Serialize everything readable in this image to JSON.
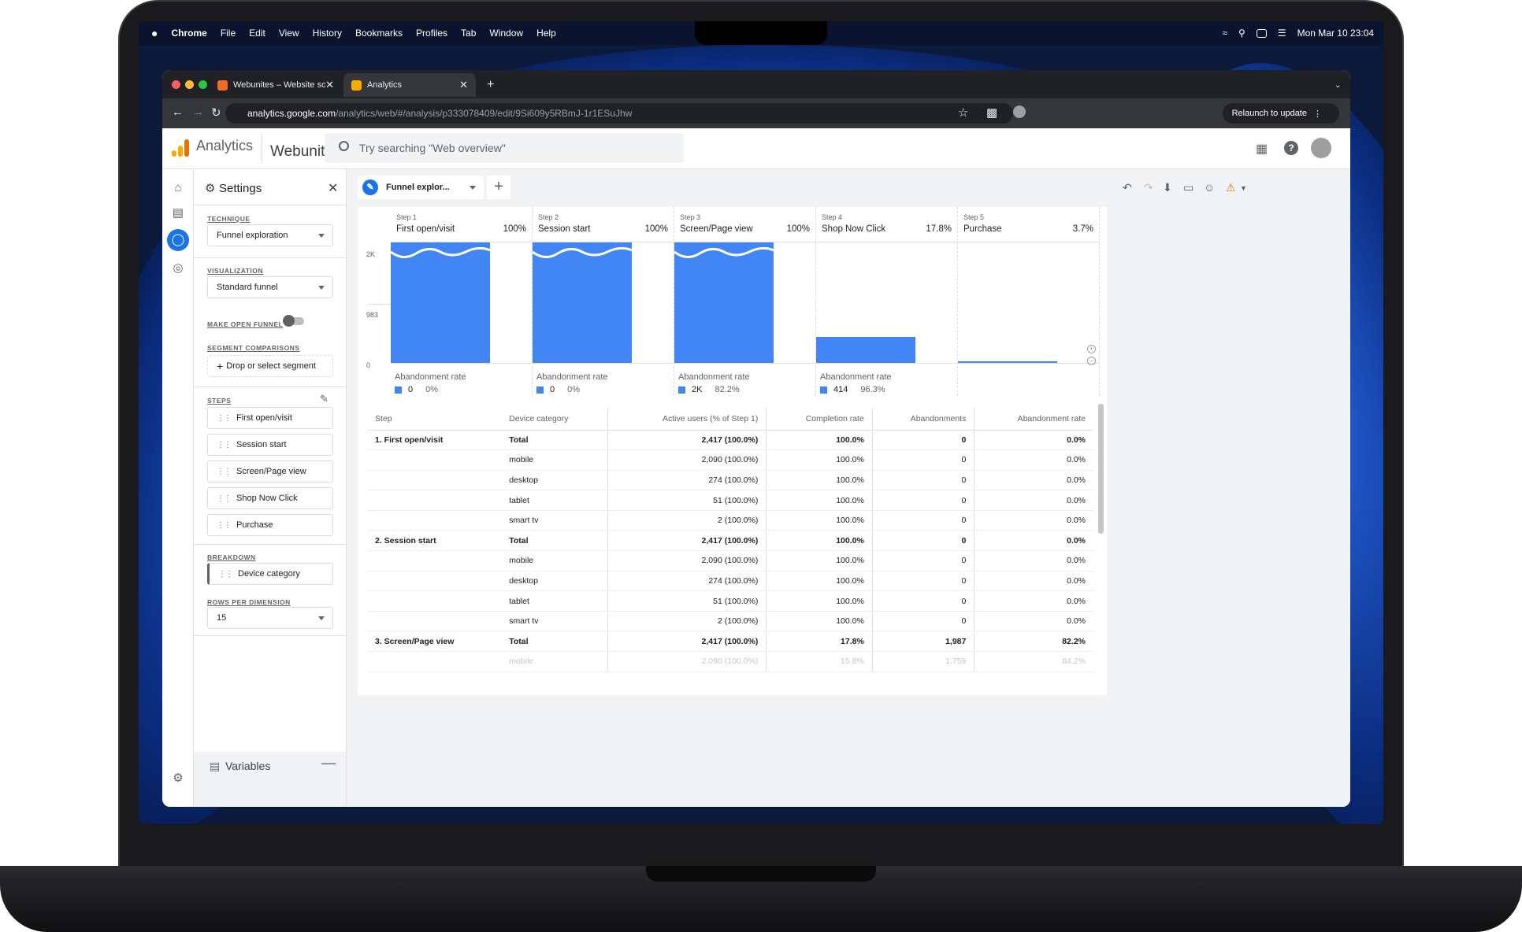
{
  "menubar": {
    "apple": "",
    "items": [
      "Chrome",
      "File",
      "Edit",
      "View",
      "History",
      "Bookmarks",
      "Profiles",
      "Tab",
      "Window",
      "Help"
    ],
    "clock": "Mon Mar 10  23:04"
  },
  "browser": {
    "tabs": [
      {
        "title": "Webunites – Website solution"
      },
      {
        "title": "Analytics"
      }
    ],
    "url_host": "analytics.google.com",
    "url_path": "/analytics/web/#/analysis/p333078409/edit/9Si609y5RBmJ-1r1ESuJhw",
    "relaunch": "Relaunch to update"
  },
  "ga": {
    "product": "Analytics",
    "property": "Webunites",
    "search_placeholder": "Try searching \"Web overview\""
  },
  "settings": {
    "title": "Settings",
    "technique_label": "TECHNIQUE",
    "technique_value": "Funnel exploration",
    "visualization_label": "VISUALIZATION",
    "visualization_value": "Standard funnel",
    "open_funnel_label": "MAKE OPEN FUNNEL",
    "segment_label": "SEGMENT COMPARISONS",
    "segment_placeholder": "Drop or select segment",
    "steps_label": "STEPS",
    "steps": [
      "First open/visit",
      "Session start",
      "Screen/Page view",
      "Shop Now Click",
      "Purchase"
    ],
    "breakdown_label": "BREAKDOWN",
    "breakdown_value": "Device category",
    "rows_label": "ROWS PER DIMENSION",
    "rows_value": "15",
    "variables": "Variables"
  },
  "tab": {
    "label": "Funnel explor..."
  },
  "chart_data": {
    "type": "bar",
    "categories": [
      "First open/visit",
      "Session start",
      "Screen/Page view",
      "Shop Now Click",
      "Purchase"
    ],
    "step_labels": [
      "Step 1",
      "Step 2",
      "Step 3",
      "Step 4",
      "Step 5"
    ],
    "percent_labels": [
      "100%",
      "100%",
      "100%",
      "17.8%",
      "3.7%"
    ],
    "values": [
      2417,
      2417,
      2417,
      430,
      16
    ],
    "y_ticks": [
      "2K",
      "983",
      "0"
    ],
    "ylim": [
      0,
      2000
    ],
    "abandonment_label": "Abandonment rate",
    "abandonment": [
      {
        "count": "0",
        "rate": "0%"
      },
      {
        "count": "0",
        "rate": "0%"
      },
      {
        "count": "2K",
        "rate": "82.2%"
      },
      {
        "count": "414",
        "rate": "96.3%"
      }
    ]
  },
  "table": {
    "headers": [
      "Step",
      "Device category",
      "Active users (% of Step 1)",
      "Completion rate",
      "Abandonments",
      "Abandonment rate"
    ],
    "rows": [
      [
        "1. First open/visit",
        "Total",
        "2,417 (100.0%)",
        "100.0%",
        "0",
        "0.0%"
      ],
      [
        "",
        "mobile",
        "2,090 (100.0%)",
        "100.0%",
        "0",
        "0.0%"
      ],
      [
        "",
        "desktop",
        "274 (100.0%)",
        "100.0%",
        "0",
        "0.0%"
      ],
      [
        "",
        "tablet",
        "51 (100.0%)",
        "100.0%",
        "0",
        "0.0%"
      ],
      [
        "",
        "smart tv",
        "2 (100.0%)",
        "100.0%",
        "0",
        "0.0%"
      ],
      [
        "2. Session start",
        "Total",
        "2,417 (100.0%)",
        "100.0%",
        "0",
        "0.0%"
      ],
      [
        "",
        "mobile",
        "2,090 (100.0%)",
        "100.0%",
        "0",
        "0.0%"
      ],
      [
        "",
        "desktop",
        "274 (100.0%)",
        "100.0%",
        "0",
        "0.0%"
      ],
      [
        "",
        "tablet",
        "51 (100.0%)",
        "100.0%",
        "0",
        "0.0%"
      ],
      [
        "",
        "smart tv",
        "2 (100.0%)",
        "100.0%",
        "0",
        "0.0%"
      ],
      [
        "3. Screen/Page view",
        "Total",
        "2,417 (100.0%)",
        "17.8%",
        "1,987",
        "82.2%"
      ],
      [
        "",
        "mobile",
        "2,090 (100.0%)",
        "15.8%",
        "1,759",
        "84.2%"
      ]
    ],
    "total_rows": [
      0,
      5,
      10
    ],
    "faded_rows": [
      11
    ]
  },
  "colors": {
    "bar": "#4285f4",
    "ga_orange": "#f9ab00",
    "accent": "#1a73e8"
  }
}
